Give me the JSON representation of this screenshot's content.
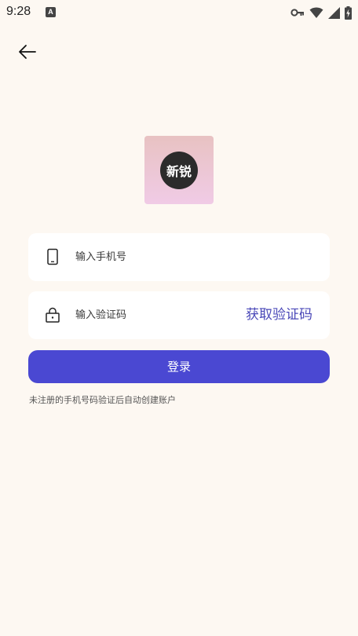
{
  "status_bar": {
    "time": "9:28",
    "app_icon": "A"
  },
  "logo": {
    "text": "新锐"
  },
  "phone_field": {
    "placeholder": "输入手机号",
    "value": "",
    "icon": "phone-icon"
  },
  "code_field": {
    "placeholder": "输入验证码",
    "value": "",
    "icon": "lock-icon",
    "get_code_label": "获取验证码"
  },
  "login_button": {
    "label": "登录"
  },
  "hint": {
    "text": "未注册的手机号码验证后自动创建账户"
  },
  "colors": {
    "background": "#fdf8f2",
    "primary": "#4a48d2",
    "link": "#4a48b8"
  }
}
